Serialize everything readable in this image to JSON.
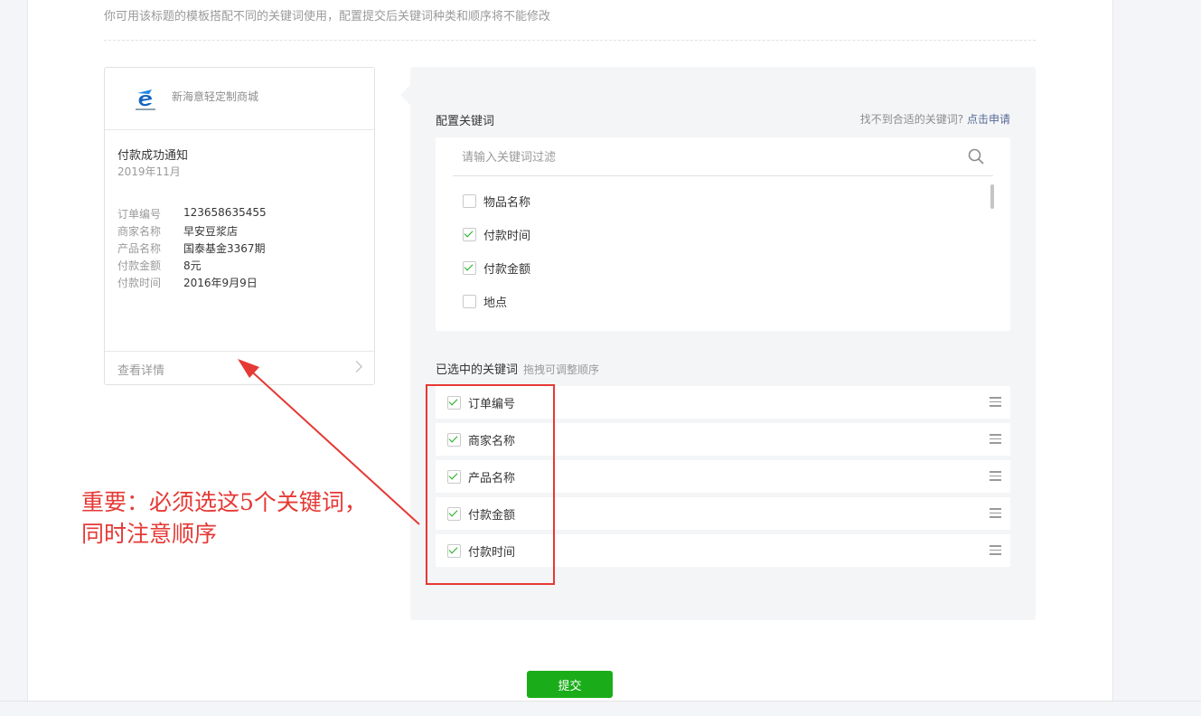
{
  "hint": "你可用该标题的模板搭配不同的关键词使用，配置提交后关键词种类和顺序将不能修改",
  "preview": {
    "brand": "新海意轻定制商城",
    "title": "付款成功通知",
    "date": "2019年11月",
    "fields": [
      {
        "k": "订单编号",
        "v": "123658635455"
      },
      {
        "k": "商家名称",
        "v": "早安豆浆店"
      },
      {
        "k": "产品名称",
        "v": "国泰基金3367期"
      },
      {
        "k": "付款金额",
        "v": "8元"
      },
      {
        "k": "付款时间",
        "v": "2016年9月9日"
      }
    ],
    "detail": "查看详情"
  },
  "config": {
    "label": "配置关键词",
    "apply_prefix": "找不到合适的关键词?",
    "apply_link": "点击申请",
    "filter_placeholder": "请输入关键词过滤",
    "options": [
      {
        "label": "物品名称",
        "checked": false
      },
      {
        "label": "付款时间",
        "checked": true
      },
      {
        "label": "付款金额",
        "checked": true
      },
      {
        "label": "地点",
        "checked": false
      }
    ]
  },
  "selected": {
    "label": "已选中的关键词",
    "sub": "拖拽可调整顺序",
    "items": [
      "订单编号",
      "商家名称",
      "产品名称",
      "付款金额",
      "付款时间"
    ]
  },
  "annotation": {
    "line1": "重要：必须选这5个关键词，",
    "line2": "同时注意顺序"
  },
  "submit": "提交",
  "colors": {
    "accent": "#1aad19",
    "annotation": "#e53935",
    "link": "#576b95"
  }
}
